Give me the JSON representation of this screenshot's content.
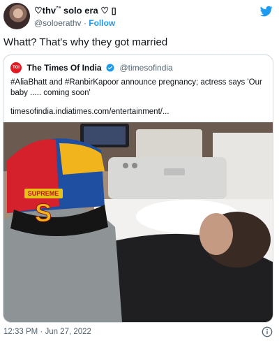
{
  "user": {
    "display_name": "♡thv",
    "display_sup": "⁷⁹",
    "display_suffix": " solo era ♡ ",
    "display_glyph": "▯",
    "handle": "@soloerathv",
    "separator": "·",
    "follow_label": "Follow"
  },
  "tweet": {
    "text": "Whatt? That's why they got married",
    "timestamp": "12:33 PM · Jun 27, 2022"
  },
  "quoted": {
    "logo_text": "TOI",
    "name": "The Times Of India",
    "handle": "@timesofindia",
    "text": "#AliaBhatt and #RanbirKapoor announce pregnancy; actress says 'Our baby ..... coming soon'",
    "link": "timesofindia.indiatimes.com/entertainment/..."
  },
  "photo": {
    "cap_letter": "S",
    "cap_text": "SUPREME"
  },
  "colors": {
    "accent": "#1d9bf0",
    "toi_red": "#e21b22",
    "text": "#0f1419",
    "muted": "#536471",
    "border": "#cfd9de"
  },
  "icons": [
    "twitter-bird-icon",
    "verified-badge-icon",
    "info-icon"
  ]
}
